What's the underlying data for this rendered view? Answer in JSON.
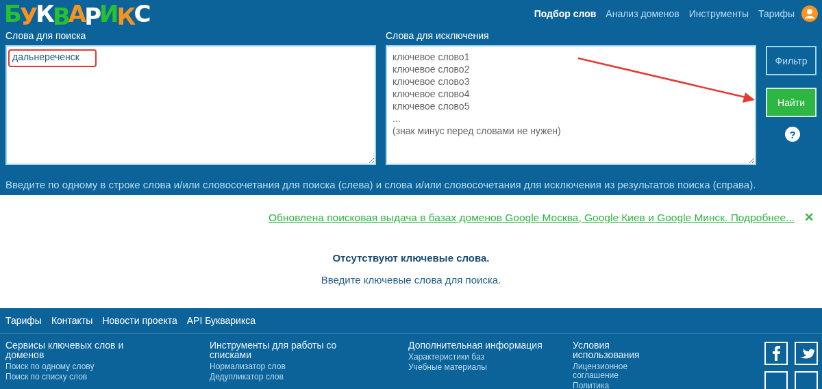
{
  "header": {
    "logo": "БУКВАРИКС",
    "nav": [
      {
        "label": "Подбор слов",
        "selected": true
      },
      {
        "label": "Анализ доменов",
        "selected": false
      },
      {
        "label": "Инструменты",
        "selected": false
      },
      {
        "label": "Тарифы",
        "selected": false
      }
    ]
  },
  "search": {
    "include_label": "Слова для поиска",
    "include_value": "дальнереченск",
    "exclude_label": "Слова для исключения",
    "exclude_placeholder": "ключевое слово1\nключевое слово2\nключевое слово3\nключевое слово4\nключевое слово5\n...\n(знак минус перед словами не нужен)",
    "filter_button": "Фильтр",
    "find_button": "Найти",
    "help": "?",
    "hint": "Введите по одному в строке слова и/или словосочетания для поиска (слева) и слова и/или словосочетания для исключения из результатов поиска (справа)."
  },
  "notice": {
    "text": "Обновлена поисковая выдача в базах доменов Google Москва, Google Киев и Google Минск. Подробнее...",
    "close": "✕"
  },
  "empty": {
    "title": "Отсутствуют ключевые слова.",
    "text": "Введите ключевые слова для поиска."
  },
  "footer": {
    "links": [
      "Тарифы",
      "Контакты",
      "Новости проекта",
      "API Букварикса"
    ],
    "columns": [
      {
        "title": "Сервисы ключевых слов и доменов",
        "links": [
          "Поиск по одному слову",
          "Поиск по списку слов"
        ]
      },
      {
        "title": "Инструменты для работы со списками",
        "links": [
          "Нормализатор слов",
          "Дедупликатор слов"
        ]
      },
      {
        "title": "Дополнительная информация",
        "links": [
          "Характеристики баз",
          "Учебные материалы"
        ]
      },
      {
        "title": "Условия использования",
        "links": [
          "Лицензионное соглашение",
          "Политика"
        ]
      }
    ]
  }
}
